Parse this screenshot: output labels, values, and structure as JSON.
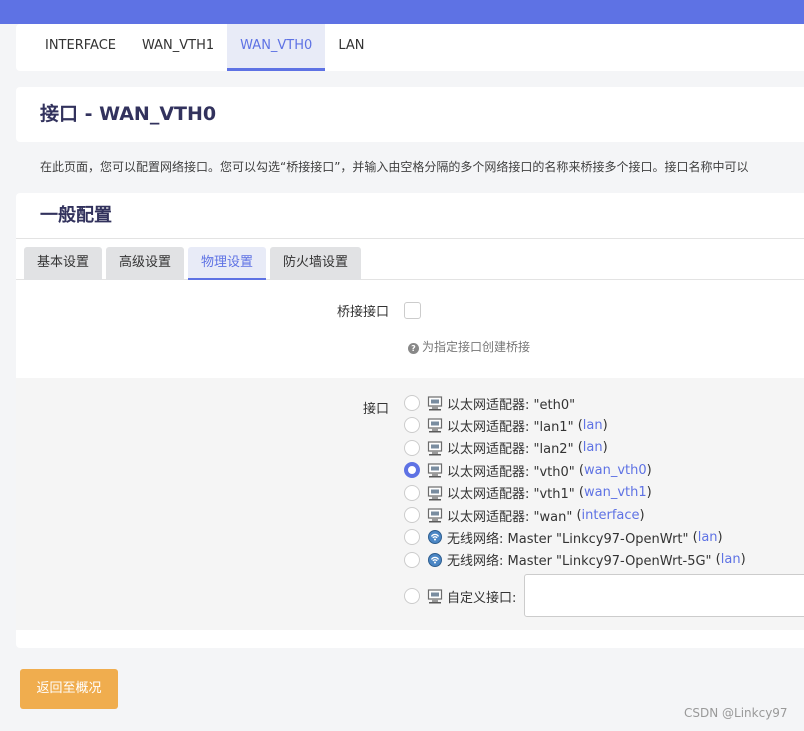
{
  "iface_tabs": [
    {
      "label": "INTERFACE",
      "active": false
    },
    {
      "label": "WAN_VTH1",
      "active": false
    },
    {
      "label": "WAN_VTH0",
      "active": true
    },
    {
      "label": "LAN",
      "active": false
    }
  ],
  "page_title": "接口 - WAN_VTH0",
  "description": "在此页面，您可以配置网络接口。您可以勾选“桥接接口”，并输入由空格分隔的多个网络接口的名称来桥接多个接口。接口名称中可以",
  "section_title": "一般配置",
  "cbi_tabs": [
    {
      "label": "基本设置",
      "active": false
    },
    {
      "label": "高级设置",
      "active": false
    },
    {
      "label": "物理设置",
      "active": true
    },
    {
      "label": "防火墙设置",
      "active": false
    }
  ],
  "bridge": {
    "label": "桥接接口",
    "checked": false,
    "hint": "为指定接口创建桥接"
  },
  "interface_field": {
    "label": "接口",
    "options": [
      {
        "text": "以太网适配器: \"eth0\"",
        "network": "",
        "icon": "ethernet-icon",
        "checked": false
      },
      {
        "text": "以太网适配器: \"lan1\"",
        "network": "lan",
        "icon": "ethernet-icon",
        "checked": false
      },
      {
        "text": "以太网适配器: \"lan2\"",
        "network": "lan",
        "icon": "ethernet-icon",
        "checked": false
      },
      {
        "text": "以太网适配器: \"vth0\"",
        "network": "wan_vth0",
        "icon": "ethernet-icon",
        "checked": true
      },
      {
        "text": "以太网适配器: \"vth1\"",
        "network": "wan_vth1",
        "icon": "ethernet-icon",
        "checked": false
      },
      {
        "text": "以太网适配器: \"wan\"",
        "network": "interface",
        "icon": "ethernet-icon",
        "checked": false
      },
      {
        "text": "无线网络: Master \"Linkcy97-OpenWrt\"",
        "network": "lan",
        "icon": "wireless-icon",
        "checked": false
      },
      {
        "text": "无线网络: Master \"Linkcy97-OpenWrt-5G\"",
        "network": "lan",
        "icon": "wireless-icon",
        "checked": false
      }
    ],
    "custom_label": "自定义接口:",
    "custom_value": ""
  },
  "back_button": "返回至概况",
  "watermark": "CSDN @Linkcy97",
  "colors": {
    "accent": "#5e72e4",
    "button": "#f0ad4e"
  }
}
